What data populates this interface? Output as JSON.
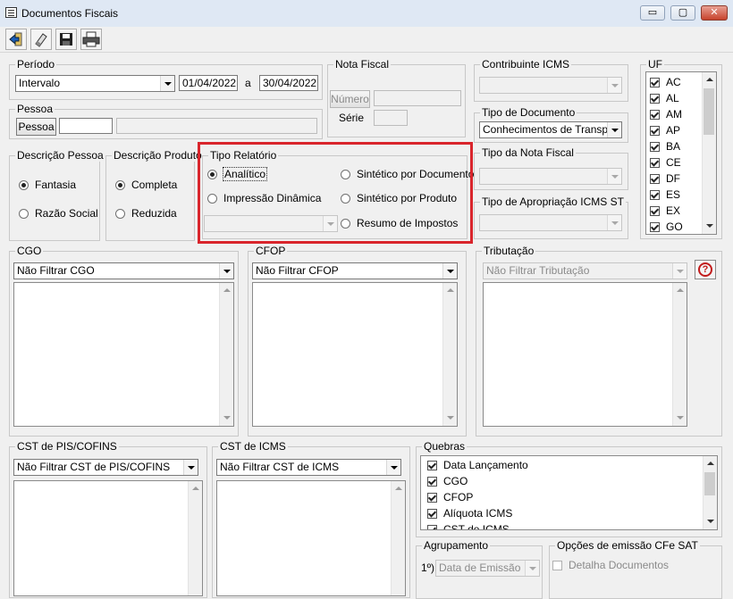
{
  "window": {
    "title": "Documentos Fiscais",
    "minimize_glyph": "▭",
    "maximize_glyph": "▢",
    "close_glyph": "✕"
  },
  "toolbar": {
    "buttons": [
      "exit-icon",
      "eraser-icon",
      "save-icon",
      "print-icon"
    ]
  },
  "periodo": {
    "legend": "Período",
    "type_value": "Intervalo",
    "date_from": "01/04/2022",
    "separator": "a",
    "date_to": "30/04/2022"
  },
  "nota_fiscal": {
    "legend": "Nota Fiscal",
    "numero_button": "Número",
    "serie_label": "Série"
  },
  "contribuinte": {
    "legend": "Contribuinte ICMS"
  },
  "tipo_documento": {
    "legend": "Tipo de Documento",
    "value": "Conhecimentos de Transport"
  },
  "tipo_nota": {
    "legend": "Tipo da Nota Fiscal"
  },
  "tipo_apropriacao": {
    "legend": "Tipo de Apropriação ICMS ST"
  },
  "uf": {
    "legend": "UF",
    "items": [
      "AC",
      "AL",
      "AM",
      "AP",
      "BA",
      "CE",
      "DF",
      "ES",
      "EX",
      "GO"
    ]
  },
  "pessoa": {
    "legend": "Pessoa",
    "button": "Pessoa"
  },
  "descricao_pessoa": {
    "legend": "Descrição Pessoa",
    "options": [
      "Fantasia",
      "Razão Social"
    ],
    "selected": 0
  },
  "descricao_produto": {
    "legend": "Descrição Produto",
    "options": [
      "Completa",
      "Reduzida"
    ],
    "selected": 0
  },
  "tipo_relatorio": {
    "legend": "Tipo Relatório",
    "options": [
      "Analítico",
      "Impressão Dinâmica",
      "Sintético por Documento",
      "Sintético por Produto",
      "Resumo de Impostos"
    ],
    "selected": "Analítico"
  },
  "cgo": {
    "legend": "CGO",
    "value": "Não Filtrar CGO"
  },
  "cfop": {
    "legend": "CFOP",
    "value": "Não Filtrar CFOP"
  },
  "tributacao": {
    "legend": "Tributação",
    "value": "Não Filtrar Tributação"
  },
  "cst_pis": {
    "legend": "CST de PIS/COFINS",
    "value": "Não Filtrar CST de PIS/COFINS"
  },
  "cst_icms": {
    "legend": "CST de ICMS",
    "value": "Não Filtrar CST de ICMS"
  },
  "quebras": {
    "legend": "Quebras",
    "items": [
      "Data Lançamento",
      "CGO",
      "CFOP",
      "Alíquota ICMS",
      "CST de ICMS"
    ]
  },
  "agrupamento": {
    "legend": "Agrupamento",
    "ordinal": "1º)",
    "value": "Data de Emissão"
  },
  "cfe_sat": {
    "legend": "Opções de emissão CFe SAT",
    "detalha": "Detalha Documentos"
  },
  "colors": {
    "highlight": "#d9252c",
    "background": "#f0f0f0"
  }
}
